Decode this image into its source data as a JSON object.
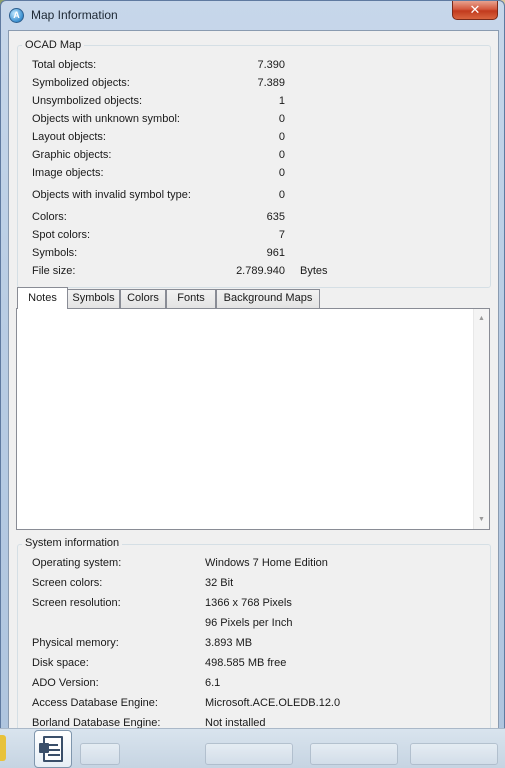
{
  "window": {
    "title": "Map Information",
    "app_icon": "ocad-app-icon",
    "close_icon": "close-icon",
    "close_glyph": "✕"
  },
  "ocad_map": {
    "legend": "OCAD Map",
    "stats": [
      {
        "label": "Total objects:",
        "value": "7.390"
      },
      {
        "label": "Symbolized objects:",
        "value": "7.389"
      },
      {
        "label": "Unsymbolized objects:",
        "value": "1"
      },
      {
        "label": "Objects with unknown symbol:",
        "value": "0"
      },
      {
        "label": "Layout objects:",
        "value": "0"
      },
      {
        "label": "Graphic objects:",
        "value": "0"
      },
      {
        "label": "Image objects:",
        "value": "0"
      },
      {
        "label": "Objects with invalid symbol type:",
        "value": "0"
      },
      {
        "label": "Colors:",
        "value": "635"
      },
      {
        "label": "Spot colors:",
        "value": "7"
      },
      {
        "label": "Symbols:",
        "value": "961"
      },
      {
        "label": "File size:",
        "value": "2.789.940",
        "unit": "Bytes"
      }
    ]
  },
  "tabs": [
    {
      "label": "Notes",
      "active": true
    },
    {
      "label": "Symbols",
      "active": false
    },
    {
      "label": "Colors",
      "active": false
    },
    {
      "label": "Fonts",
      "active": false
    },
    {
      "label": "Background Maps",
      "active": false
    }
  ],
  "notes": {
    "scroll_up_icon": "scroll-up-arrow-icon",
    "scroll_down_icon": "scroll-down-arrow-icon",
    "up_glyph": "▲",
    "down_glyph": "▼"
  },
  "system_info": {
    "legend": "System information",
    "rows": [
      {
        "label": "Operating system:",
        "value": "Windows 7 Home Edition"
      },
      {
        "label": "Screen colors:",
        "value": "32 Bit"
      },
      {
        "label": "Screen resolution:",
        "value": "1366 x 768 Pixels"
      },
      {
        "label": "",
        "value": "96 Pixels per Inch"
      },
      {
        "label": "Physical memory:",
        "value": "3.893 MB"
      },
      {
        "label": "Disk space:",
        "value": "498.585 MB free"
      },
      {
        "label": "ADO Version:",
        "value": "6.1"
      },
      {
        "label": "Access Database Engine:",
        "value": "Microsoft.ACE.OLEDB.12.0"
      },
      {
        "label": "Borland Database Engine:",
        "value": "Not installed"
      }
    ]
  },
  "taskbar": {
    "icon": "document-editor-icon"
  },
  "colors": {
    "title_bar": "#b9cde4",
    "close_button": "#c23a1e",
    "client_bg": "#f0f0f0",
    "group_border": "#d5dfe5"
  }
}
